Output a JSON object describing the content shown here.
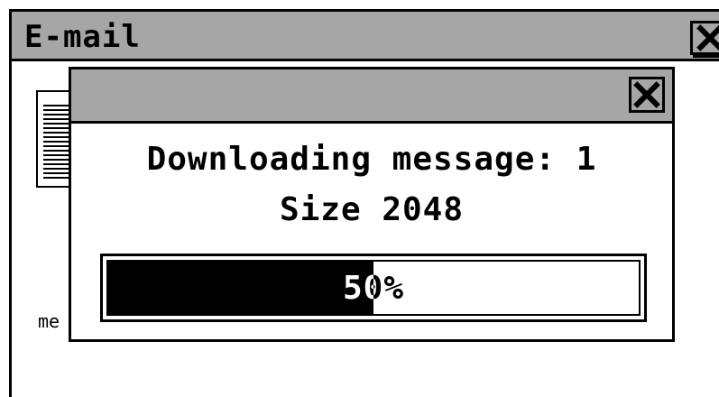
{
  "main_window": {
    "title": "E-mail",
    "background_label": "me",
    "close_icon": "close-icon"
  },
  "dialog": {
    "close_icon": "close-icon",
    "message_line": "Downloading message: 1",
    "size_line": "Size 2048",
    "progress": {
      "value": 0.5,
      "label": "50%"
    }
  },
  "colors": {
    "titlebar": "#a6a6a6",
    "fill": "#000000",
    "background": "#ffffff"
  }
}
